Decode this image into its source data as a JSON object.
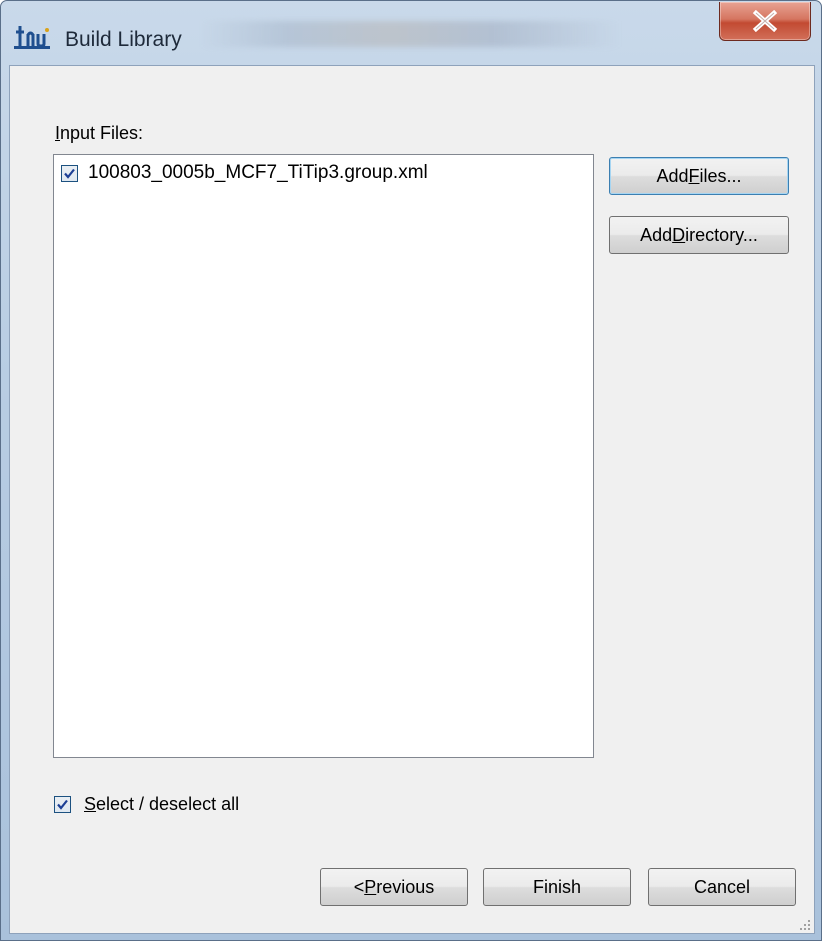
{
  "window": {
    "title": "Build Library"
  },
  "input_files": {
    "label_accel": "I",
    "label_rest": "nput Files:",
    "items": [
      {
        "name": "100803_0005b_MCF7_TiTip3.group.xml",
        "checked": true
      }
    ]
  },
  "buttons": {
    "add_files_pre": "Add ",
    "add_files_accel": "F",
    "add_files_post": "iles...",
    "add_directory_pre": "Add ",
    "add_directory_accel": "D",
    "add_directory_post": "irectory...",
    "previous_pre": "< ",
    "previous_accel": "P",
    "previous_post": "revious",
    "finish": "Finish",
    "cancel": "Cancel"
  },
  "select_all": {
    "accel": "S",
    "rest": "elect / deselect all",
    "checked": true
  },
  "colors": {
    "titlebar": "#b8cde3",
    "close_button": "#c24a32",
    "client_background": "#f0f0f0",
    "default_button_border": "#3c7fb1"
  },
  "icons": {
    "app": "build-library-icon",
    "close": "close-icon",
    "check": "check-icon",
    "grip": "resize-grip-icon"
  }
}
